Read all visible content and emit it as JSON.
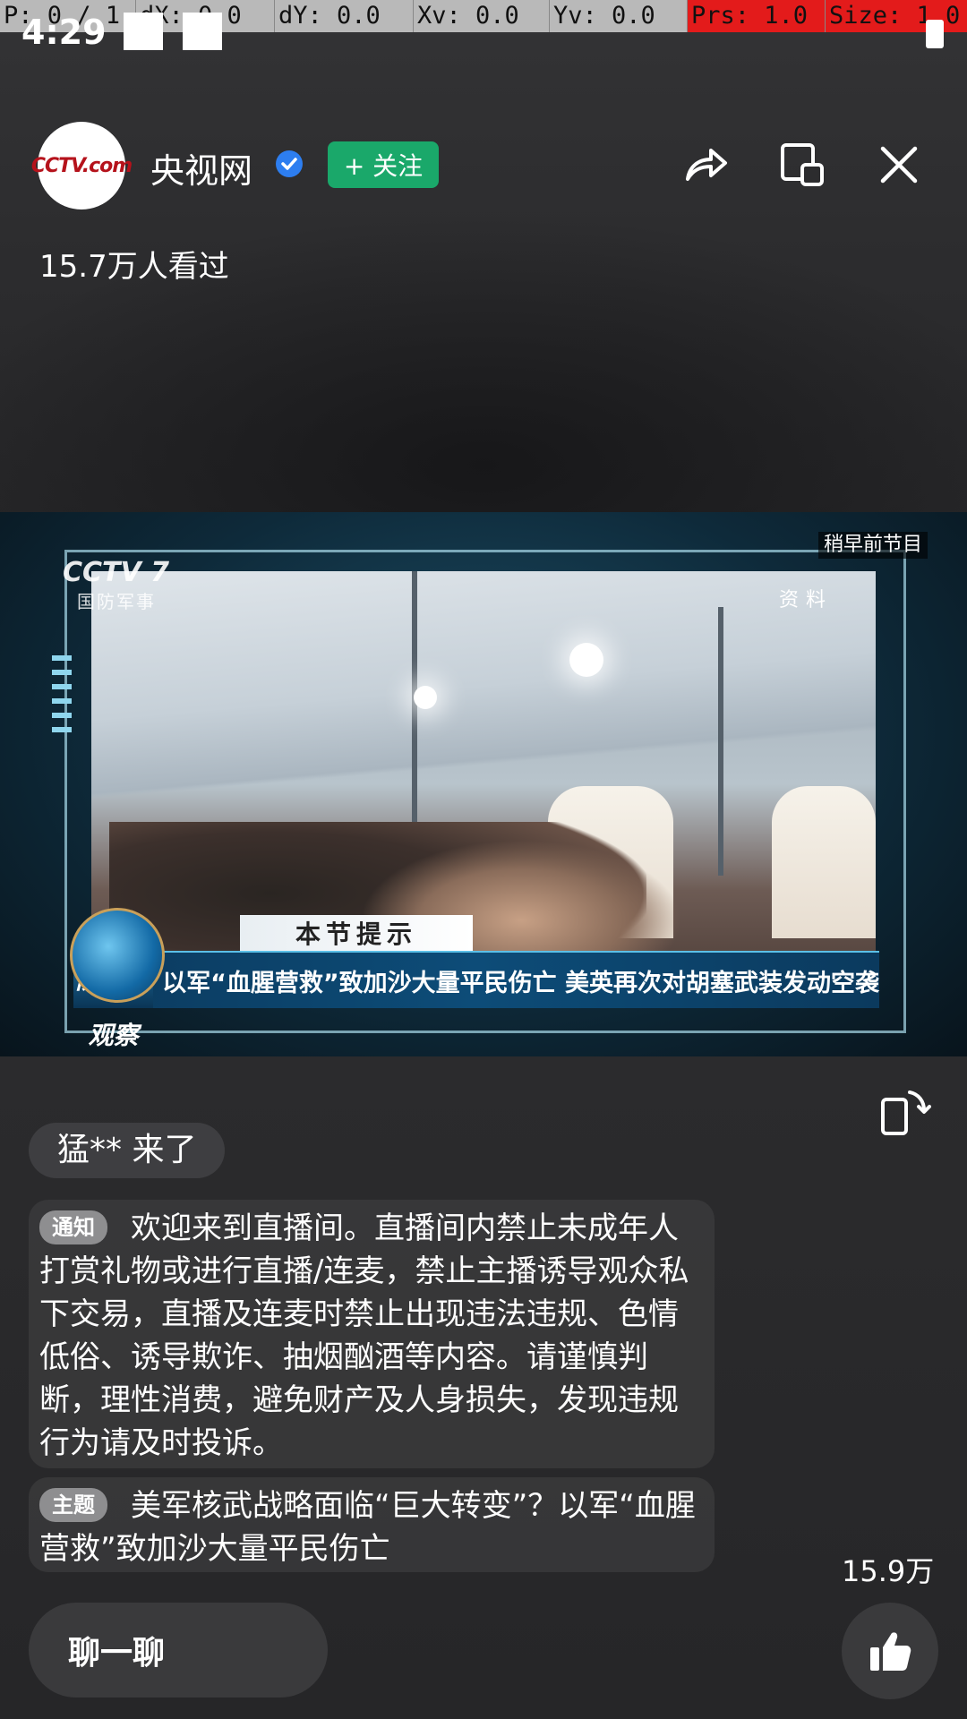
{
  "debug": {
    "p": "P: 0 / 1",
    "dx": "dX: 0.0",
    "dy": "dY: 0.0",
    "xv": "Xv: 0.0",
    "yv": "Yv: 0.0",
    "prs": "Prs: 1.0",
    "size": "Size: 1.0"
  },
  "status_bar": {
    "time": "4:29"
  },
  "header": {
    "avatar_text": "CCTV.com",
    "channel_name": "央视网",
    "follow_label": "+ 关注",
    "views": "15.7万人看过",
    "icons": [
      "share-icon",
      "pip-icon",
      "close-icon"
    ]
  },
  "video": {
    "earlier_badge": "稍早前节目",
    "channel_logo": "CCTV 7",
    "channel_sub": "国防军事",
    "source_tag": "资料",
    "tip_label": "本节提示",
    "show_name": "防务新观察",
    "headline": "以军“血腥营救”致加沙大量平民伤亡   美英再次对胡塞武装发动空袭"
  },
  "comments": {
    "arrival": "猛** 来了",
    "notice_tag": "通知",
    "notice_text": "欢迎来到直播间。直播间内禁止未成年人打赏礼物或进行直播/连麦，禁止主播诱导观众私下交易，直播及连麦时禁止出现违法违规、色情低俗、诱导欺诈、抽烟酗酒等内容。请谨慎判断，理性消费，避免财产及人身损失，发现违规行为请及时投诉。",
    "topic_tag": "主题",
    "topic_text": "美军核武战略面临“巨大转变”？以军“血腥营救”致加沙大量平民伤亡"
  },
  "likes": {
    "count": "15.9万"
  },
  "bottom": {
    "chat_placeholder": "聊一聊"
  },
  "colors": {
    "follow_green": "#1aa86a",
    "verified_blue": "#2d7ef0",
    "debug_red": "#e31b1b"
  }
}
